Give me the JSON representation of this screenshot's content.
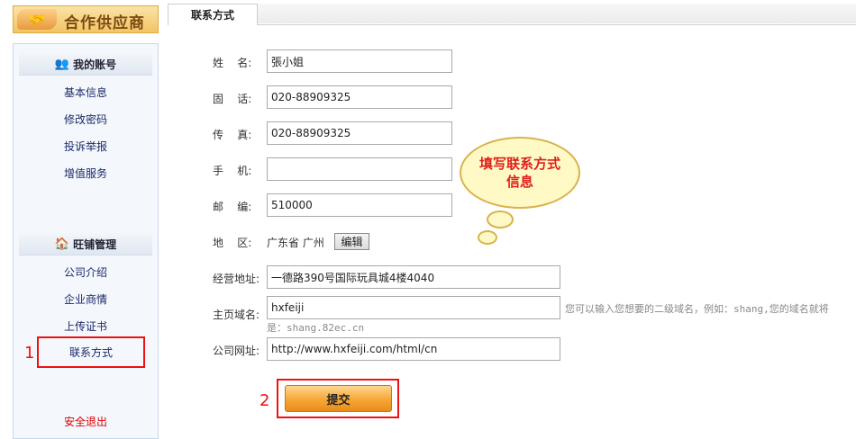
{
  "logo": {
    "text": "合作供应商",
    "icon": "handshake-icon"
  },
  "sidebar": {
    "account": {
      "title": "我的账号",
      "icon": "users-icon",
      "items": [
        "基本信息",
        "修改密码",
        "投诉举报",
        "增值服务"
      ]
    },
    "shop": {
      "title": "旺铺管理",
      "icon": "home-icon",
      "items": [
        "公司介绍",
        "企业商情",
        "上传证书",
        "联系方式"
      ]
    },
    "logout": "安全退出",
    "active_item": "联系方式"
  },
  "tab": {
    "label": "联系方式"
  },
  "form": {
    "name": {
      "label": "姓    名:",
      "value": "張小姐"
    },
    "phone": {
      "label": "固    话:",
      "value": "020-88909325"
    },
    "fax": {
      "label": "传    真:",
      "value": "020-88909325"
    },
    "mobile": {
      "label": "手    机:",
      "value": ""
    },
    "zip": {
      "label": "邮    编:",
      "value": "510000"
    },
    "region": {
      "label": "地    区:",
      "value": "广东省  广州",
      "edit_label": "编辑"
    },
    "address": {
      "label": "经营地址:",
      "value": "一德路390号国际玩具城4楼4040"
    },
    "domain": {
      "label": "主页域名:",
      "value": "hxfeiji",
      "hint": "您可以输入您想要的二级域名，例如：shang,您的域名就将",
      "hint2": "是：shang.82ec.cn"
    },
    "website": {
      "label": "公司网址:",
      "value": "http://www.hxfeiji.com/html/cn"
    },
    "submit_label": "提交"
  },
  "annotations": {
    "callout": "填写联系方式信息",
    "step1": "1",
    "step2": "2",
    "highlight_color": "#e11111"
  }
}
